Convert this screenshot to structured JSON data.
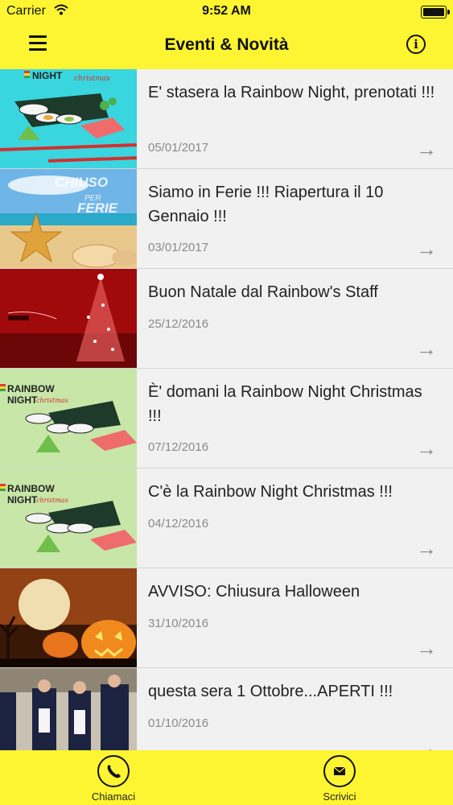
{
  "status": {
    "carrier": "Carrier",
    "time": "9:52 AM"
  },
  "header": {
    "title": "Eventi & Novità"
  },
  "events": [
    {
      "title": "E' stasera la Rainbow Night, prenotati !!!",
      "date": "05/01/2017"
    },
    {
      "title": "Siamo in Ferie !!! Riapertura il 10 Gennaio !!!",
      "date": "03/01/2017"
    },
    {
      "title": "Buon Natale dal Rainbow's Staff",
      "date": "25/12/2016"
    },
    {
      "title": "È' domani la Rainbow Night Christmas !!!",
      "date": "07/12/2016"
    },
    {
      "title": "C'è la Rainbow Night Christmas !!!",
      "date": "04/12/2016"
    },
    {
      "title": "AVVISO: Chiusura Halloween",
      "date": "31/10/2016"
    },
    {
      "title": "questa sera 1 Ottobre...APERTI !!!",
      "date": "01/10/2016"
    }
  ],
  "thumb_text": {
    "rainbow": "RAINBOW",
    "night": "NIGHT",
    "christmas": "christmas",
    "chiuso": "CHIUSO",
    "per": "PER",
    "ferie": "FERIE"
  },
  "tabs": {
    "call": "Chiamaci",
    "write": "Scrivici"
  },
  "colors": {
    "brand_yellow": "#fdf531",
    "row_bg": "#f1f1f1",
    "date_gray": "#8a8a8a"
  }
}
